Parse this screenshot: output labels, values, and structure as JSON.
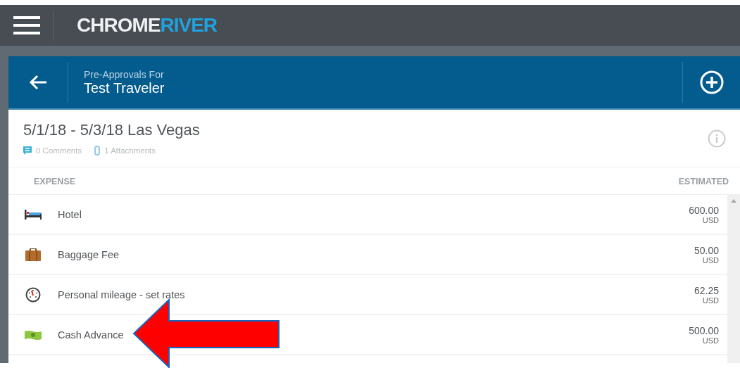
{
  "app_bar": {
    "logo": [
      "CHROME",
      "RIVER"
    ]
  },
  "header": {
    "subtitle": "Pre-Approvals For",
    "title": "Test Traveler"
  },
  "report": {
    "title": "5/1/18 - 5/3/18 Las Vegas",
    "comments": "0 Comments",
    "attachments": "1 Attachments"
  },
  "table": {
    "columns": [
      "EXPENSE",
      "ESTIMATED"
    ],
    "rows": [
      {
        "kind": "hotel",
        "name": "Hotel",
        "amount": "600.00",
        "currency": "USD"
      },
      {
        "kind": "baggage",
        "name": "Baggage Fee",
        "amount": "50.00",
        "currency": "USD"
      },
      {
        "kind": "mileage",
        "name": "Personal mileage - set rates",
        "amount": "62.25",
        "currency": "USD"
      },
      {
        "kind": "cash",
        "name": "Cash Advance",
        "amount": "500.00",
        "currency": "USD"
      }
    ]
  }
}
